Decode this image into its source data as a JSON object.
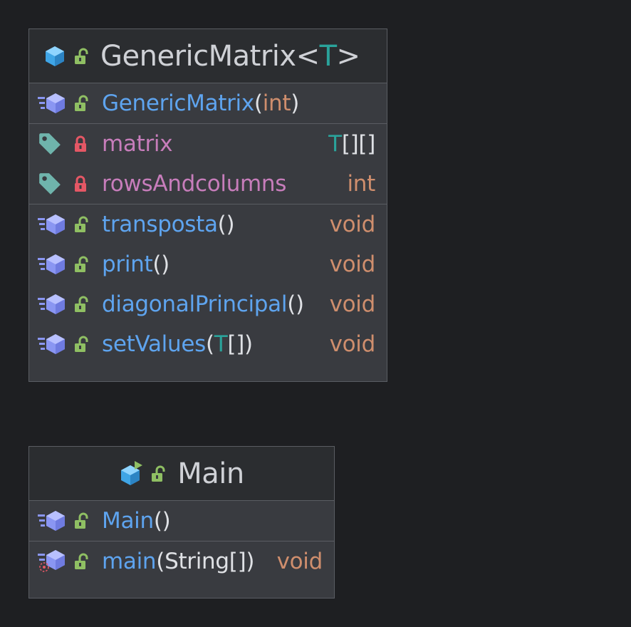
{
  "classes": [
    {
      "name": "GenericMatrix",
      "type_param_open": "<",
      "type_param": "T",
      "type_param_close": ">",
      "icon": "class-icon",
      "visibility_icon": "public-lock-icon",
      "constructors": [
        {
          "name": "GenericMatrix",
          "open": "(",
          "params": "int",
          "close": ")"
        }
      ],
      "fields": [
        {
          "name": "matrix",
          "type_t": "T",
          "type_rest": "[][]"
        },
        {
          "name": "rowsAndcolumns",
          "type": "int"
        }
      ],
      "methods": [
        {
          "name": "transposta",
          "open": "(",
          "params": "",
          "close": ")",
          "return": "void"
        },
        {
          "name": "print",
          "open": "(",
          "params": "",
          "close": ")",
          "return": "void"
        },
        {
          "name": "diagonalPrincipal",
          "open": "(",
          "params": "",
          "close": ")",
          "return": "void"
        },
        {
          "name": "setValues",
          "open": "(",
          "params_t": "T",
          "params_rest": "[]",
          "close": ")",
          "return": "void"
        }
      ]
    },
    {
      "name": "Main",
      "icon": "runnable-class-icon",
      "visibility_icon": "public-lock-icon",
      "constructors": [
        {
          "name": "Main",
          "open": "(",
          "params": "",
          "close": ")"
        }
      ],
      "methods": [
        {
          "name": "main",
          "open": "(",
          "params": "String[]",
          "close": ")",
          "return": "void"
        }
      ]
    }
  ],
  "colors": {
    "background": "#1e1f22",
    "node": "#393b40",
    "header": "#2b2d30",
    "border": "#5a5d63",
    "method": "#5ea4ef",
    "field": "#c77dbb",
    "keyword_type": "#cf8e6d",
    "type_param": "#2aa39b",
    "public_lock": "#8fbf63",
    "private_lock": "#e55765",
    "field_tag": "#6fb4ac"
  }
}
